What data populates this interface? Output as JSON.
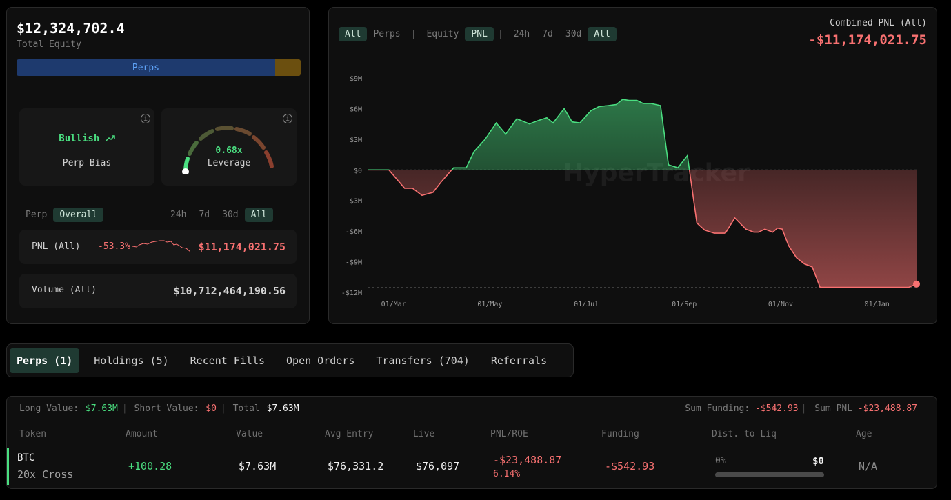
{
  "overview": {
    "total_equity_value": "$12,324,702.4",
    "total_equity_label": "Total Equity",
    "alloc_perps_label": "Perps",
    "alloc_perps_fraction": 0.91,
    "bias_value": "Bullish",
    "bias_label": "Perp Bias",
    "leverage_value": "0.68x",
    "leverage_label": "Leverage",
    "info_icon_glyph": "i",
    "scope_tabs": [
      "Perp",
      "Overall"
    ],
    "scope_active": "Overall",
    "range_tabs": [
      "24h",
      "7d",
      "30d",
      "All"
    ],
    "range_active": "All",
    "pnl_label": "PNL (All)",
    "pnl_pct": "-53.3%",
    "pnl_amount": "$11,174,021.75",
    "volume_label": "Volume (All)",
    "volume_amount": "$10,712,464,190.56"
  },
  "chart_panel": {
    "tabs_group1": [
      "All",
      "Perps"
    ],
    "tabs_group1_active": "All",
    "tabs_group2": [
      "Equity",
      "PNL"
    ],
    "tabs_group2_active": "PNL",
    "tabs_group3": [
      "24h",
      "7d",
      "30d",
      "All"
    ],
    "tabs_group3_active": "All",
    "combined_label": "Combined PNL (All)",
    "combined_value": "-$11,174,021.75",
    "watermark_title": "HyperTracker"
  },
  "chart_data": {
    "type": "area",
    "title": "",
    "xlabel": "",
    "ylabel": "",
    "y_tick_labels": [
      "$9M",
      "$6M",
      "$3M",
      "$0",
      "-$3M",
      "-$6M",
      "-$9M",
      "-$12M"
    ],
    "y_ticks": [
      9,
      6,
      3,
      0,
      -3,
      -6,
      -9,
      -12
    ],
    "x_tick_labels": [
      "01/Mar",
      "01/May",
      "01/Jul",
      "01/Sep",
      "01/Nov",
      "01/Jan"
    ],
    "x_ticks": [
      0,
      61,
      122,
      184,
      245,
      306
    ],
    "ylim": [
      -12,
      9
    ],
    "xlim": [
      -16,
      331
    ],
    "y_unit": "$M",
    "grid": false,
    "legend": "none",
    "positive_color": "#4ade80",
    "negative_color": "#f87171",
    "series": [
      {
        "x": [
          -16,
          -3,
          7,
          12,
          18,
          25,
          30,
          38,
          46,
          51,
          58,
          65,
          71,
          78,
          86,
          91,
          97,
          101,
          108,
          113,
          118,
          125,
          130,
          136,
          141,
          145,
          149,
          154,
          158,
          163,
          169,
          174,
          180,
          186,
          192,
          197,
          203,
          210,
          216,
          223,
          228,
          231,
          235,
          240,
          243,
          246,
          250,
          255,
          260,
          265,
          270,
          276,
          281,
          287,
          292,
          296,
          300,
          305,
          310,
          316,
          319,
          322,
          326,
          331
        ],
        "y": [
          0,
          0,
          -1.8,
          -1.8,
          -2.5,
          -2.2,
          -1.2,
          0.2,
          0.2,
          1.8,
          3.0,
          4.6,
          3.5,
          5.0,
          4.5,
          4.8,
          5.1,
          4.6,
          6.0,
          4.7,
          4.6,
          5.8,
          6.2,
          6.3,
          6.4,
          6.9,
          6.8,
          6.8,
          6.5,
          6.5,
          6.3,
          0.5,
          0.2,
          1.4,
          -5.2,
          -5.9,
          -6.2,
          -6.2,
          -4.7,
          -5.8,
          -6.1,
          -6.1,
          -5.8,
          -6.1,
          -5.7,
          -5.8,
          -7.4,
          -8.6,
          -9.2,
          -9.5,
          -11.5,
          -11.5,
          -11.5,
          -11.5,
          -11.5,
          -11.5,
          -11.5,
          -11.5,
          -11.5,
          -11.5,
          -11.5,
          -11.5,
          -11.5,
          -11.17
        ]
      }
    ]
  },
  "bottom_tabs": [
    "Perps (1)",
    "Holdings (5)",
    "Recent Fills",
    "Open Orders",
    "Transfers (704)",
    "Referrals"
  ],
  "bottom_tabs_active": "Perps (1)",
  "positions": {
    "long_label": "Long Value:",
    "long_value": "$7.63M",
    "short_label": "Short Value:",
    "short_value": "$0",
    "total_label": "Total",
    "total_value": "$7.63M",
    "funding_label": "Sum Funding:",
    "funding_value": "-$542.93",
    "sum_pnl_label": "Sum PNL",
    "sum_pnl_value": "-$23,488.87",
    "columns": [
      "Token",
      "Amount",
      "Value",
      "Avg Entry",
      "Live",
      "PNL/ROE",
      "Funding",
      "Dist. to Liq",
      "Age"
    ],
    "rows": [
      {
        "token": "BTC",
        "margin": "20x Cross",
        "amount": "+100.28",
        "value": "$7.63M",
        "avg_entry": "$76,331.2",
        "live": "$76,097",
        "pnl": "-$23,488.87",
        "roe": "6.14%",
        "funding": "-$542.93",
        "liq_pct": "0%",
        "liq_value": "$0",
        "age": "N/A"
      }
    ]
  }
}
